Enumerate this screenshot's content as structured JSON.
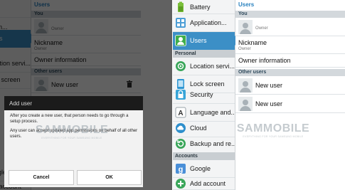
{
  "settings": {
    "items": [
      {
        "label": "Battery",
        "icon": "battery-icon"
      },
      {
        "label": "Application...",
        "icon": "application-manager-icon"
      },
      {
        "label": "Users",
        "icon": "users-icon",
        "active": true
      },
      {
        "label": "Location servi...",
        "icon": "location-icon"
      },
      {
        "label": "Lock screen",
        "icon": "lock-screen-icon"
      },
      {
        "label": "Security",
        "icon": "security-lock-icon"
      },
      {
        "label": "Language and...",
        "icon": "language-icon"
      },
      {
        "label": "Cloud",
        "icon": "cloud-icon"
      },
      {
        "label": "Backup and re...",
        "icon": "backup-icon"
      },
      {
        "label": "Google",
        "icon": "google-icon"
      },
      {
        "label": "Add account",
        "icon": "add-account-icon"
      }
    ],
    "headers": {
      "personal": "Personal",
      "accounts": "Accounts"
    }
  },
  "left_settings": {
    "rows": [
      "rs",
      "Location servi...",
      "Lock screen",
      "Google",
      "Add account"
    ]
  },
  "content": {
    "title": "Users",
    "you_header": "You",
    "owner_label": "Owner",
    "nickname_label": "Nickname",
    "nickname_sub": "Owner",
    "owner_information": "Owner information",
    "other_users_header": "Other users",
    "new_user_label": "New user"
  },
  "watermark": {
    "brand": "SAMMOBILE",
    "tagline": "EVERYTHING FOR YOUR SAMSUNG MOBILE"
  },
  "dialog": {
    "title": "Add user",
    "body1": "After you create a new user, that person needs to go through a setup process.",
    "body2": "Any user can accept updated app permissions on behalf of all other users.",
    "cancel": "Cancel",
    "ok": "OK"
  },
  "colors": {
    "accent": "#3c8fc6",
    "title_blue": "#2a82bf"
  }
}
